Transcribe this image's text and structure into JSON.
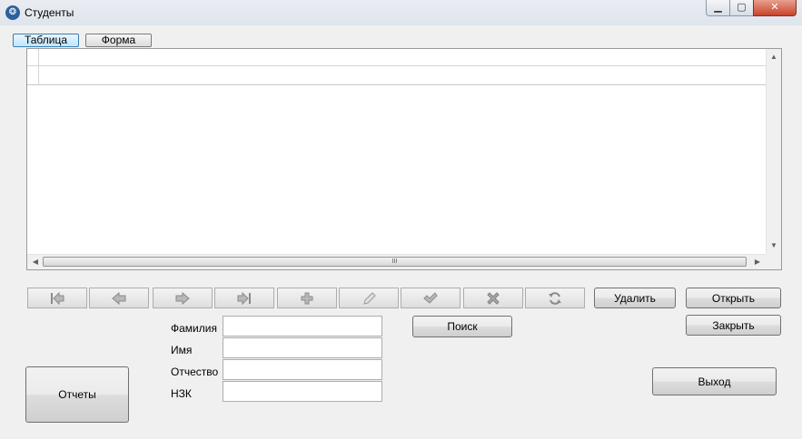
{
  "window": {
    "title": "Студенты",
    "minimize_glyph": "▁",
    "maximize_glyph": "▢",
    "close_glyph": "✕"
  },
  "tabs": [
    {
      "label": "Таблица",
      "active": true
    },
    {
      "label": "Форма",
      "active": false
    }
  ],
  "grid": {
    "rows": 1,
    "hscroll_grip": "III"
  },
  "navigator": [
    {
      "name": "first-record-button",
      "icon": "first-record-icon"
    },
    {
      "name": "prior-record-button",
      "icon": "prior-record-icon"
    },
    {
      "name": "next-record-button",
      "icon": "next-record-icon"
    },
    {
      "name": "last-record-button",
      "icon": "last-record-icon"
    },
    {
      "name": "insert-record-button",
      "icon": "plus-icon"
    },
    {
      "name": "edit-record-button",
      "icon": "pencil-icon"
    },
    {
      "name": "post-record-button",
      "icon": "checkmark-icon"
    },
    {
      "name": "cancel-record-button",
      "icon": "x-icon"
    },
    {
      "name": "refresh-button",
      "icon": "refresh-icon"
    }
  ],
  "buttons": {
    "delete": "Удалить",
    "open": "Открыть",
    "close": "Закрыть",
    "search": "Поиск",
    "reports": "Отчеты",
    "exit": "Выход"
  },
  "form": {
    "surname_label": "Фамилия",
    "surname_value": "",
    "name_label": "Имя",
    "name_value": "",
    "patronymic_label": "Отчество",
    "patronymic_value": "",
    "nzk_label": "НЗК",
    "nzk_value": ""
  }
}
